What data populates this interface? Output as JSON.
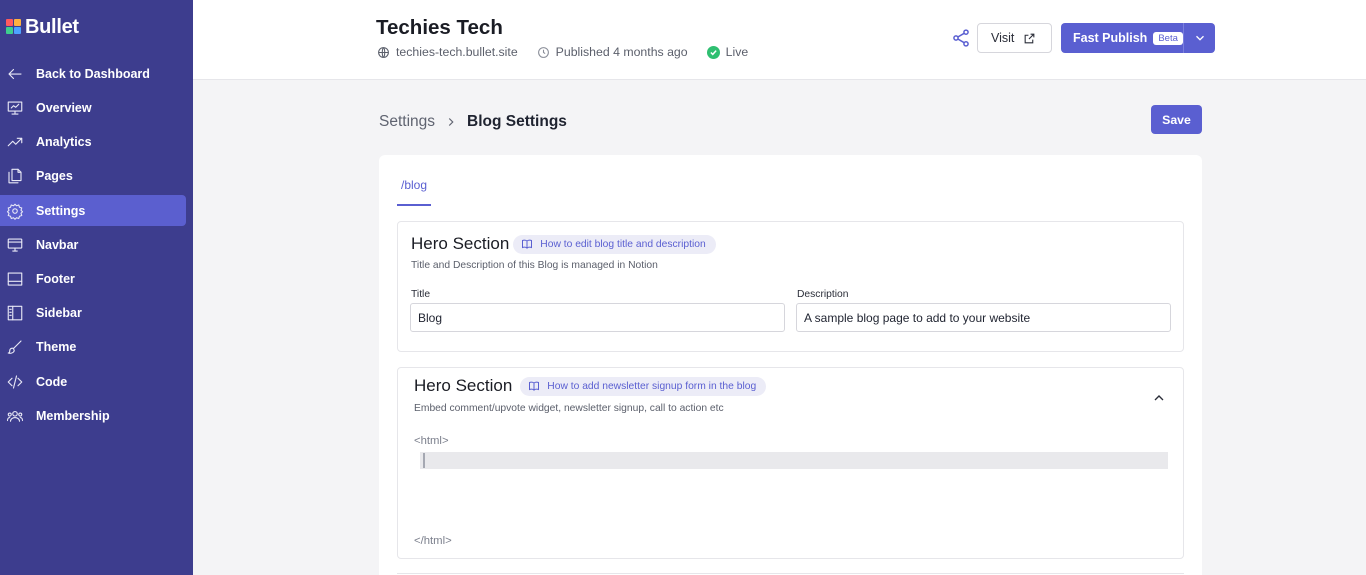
{
  "app": {
    "logo_text": "Bullet"
  },
  "sidebar": {
    "items": [
      {
        "label": "Back to Dashboard",
        "icon": "arrow-left-icon"
      },
      {
        "label": "Overview",
        "icon": "presentation-chart-icon"
      },
      {
        "label": "Analytics",
        "icon": "trend-up-icon"
      },
      {
        "label": "Pages",
        "icon": "pages-icon"
      },
      {
        "label": "Settings",
        "icon": "gear-icon",
        "active": true
      },
      {
        "label": "Navbar",
        "icon": "monitor-icon"
      },
      {
        "label": "Footer",
        "icon": "footer-icon"
      },
      {
        "label": "Sidebar",
        "icon": "sidebar-layout-icon"
      },
      {
        "label": "Theme",
        "icon": "brush-icon"
      },
      {
        "label": "Code",
        "icon": "code-icon"
      },
      {
        "label": "Membership",
        "icon": "users-icon"
      }
    ]
  },
  "header": {
    "site_title": "Techies Tech",
    "domain": "techies-tech.bullet.site",
    "published": "Published 4 months ago",
    "status": "Live",
    "visit_label": "Visit",
    "publish_label": "Fast Publish",
    "beta_label": "Beta"
  },
  "breadcrumb": {
    "parent": "Settings",
    "current": "Blog Settings"
  },
  "save_label": "Save",
  "tabs": [
    {
      "label": "/blog",
      "active": true
    }
  ],
  "hero_section": {
    "title": "Hero Section",
    "help_link": "How to edit blog title and description",
    "subtitle": "Title and Description of this Blog is managed in Notion",
    "title_label": "Title",
    "title_value": "Blog",
    "description_label": "Description",
    "description_value": "A sample blog page to add to your website"
  },
  "embed_section": {
    "title": "Hero Section",
    "help_link": "How to add newsletter signup form in the blog",
    "subtitle": "Embed comment/upvote widget, newsletter signup, call to action etc",
    "code_open": "<html>",
    "code_close": "</html>"
  },
  "colors": {
    "sidebar_bg": "#3d3d8e",
    "accent": "#5a5fd1",
    "live": "#2fbf71",
    "page_bg": "#f4f4f6"
  }
}
